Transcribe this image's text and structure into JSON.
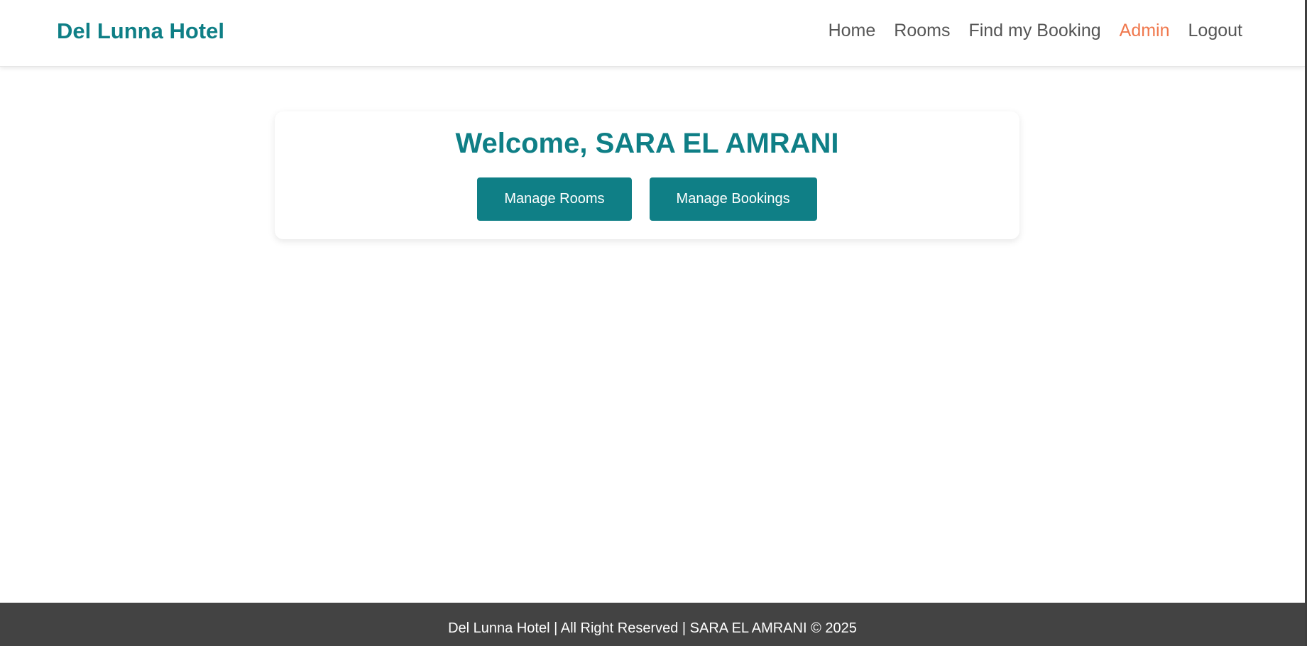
{
  "navbar": {
    "brand": "Del Lunna Hotel",
    "links": [
      {
        "label": "Home"
      },
      {
        "label": "Rooms"
      },
      {
        "label": "Find my Booking"
      },
      {
        "label": "Admin",
        "active": true
      },
      {
        "label": "Logout"
      }
    ]
  },
  "main": {
    "welcome": "Welcome, SARA EL AMRANI",
    "buttons": {
      "manage_rooms": "Manage Rooms",
      "manage_bookings": "Manage Bookings"
    }
  },
  "footer": {
    "text": "Del Lunna Hotel | All Right Reserved | SARA EL AMRANI © 2025"
  },
  "colors": {
    "brand": "#0f7f86",
    "active_nav": "#f0784d",
    "nav_text": "#555555",
    "footer_bg": "#434343"
  }
}
